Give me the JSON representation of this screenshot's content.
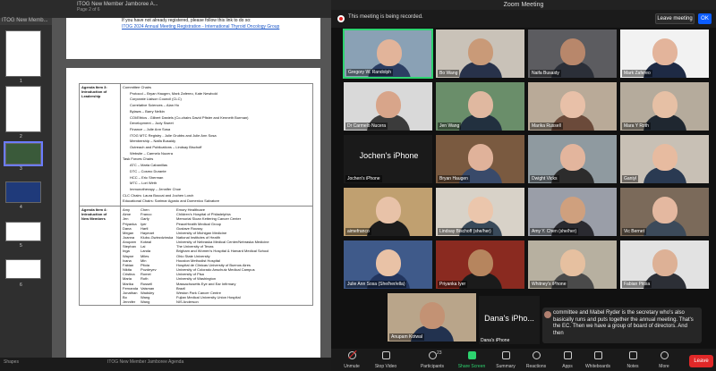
{
  "viewer": {
    "title": "ITOG New Member Jamboree A...",
    "subtitle": "Page 2 of 6",
    "window_label": "ITOG New Memb...",
    "page_numbers": [
      "1",
      "2",
      "3",
      "4",
      "5",
      "6"
    ],
    "page1_line1": "If you have not already registered, please follow this link to do so:",
    "page1_link": "ITOG 2024 Annual Meeting Registration - International Thyroid Oncology Group",
    "agenda3_head": [
      "Agenda Item 3:",
      "Introduction of",
      "Leadership"
    ],
    "leadership": [
      {
        "t": "Committee Chairs",
        "cls": ""
      },
      {
        "t": "Protocol – Bryan Haugen, Mark Zafereo, Kate Newbold",
        "cls": "bullet"
      },
      {
        "t": "Corporate Liaison Council (CLC)",
        "cls": "bullet"
      },
      {
        "t": "Correlative Sciences – Alan Ho",
        "cls": "bullet"
      },
      {
        "t": "Bylaws – Barry Nelkin",
        "cls": "bullet"
      },
      {
        "t": "COI/Ethics - Gilbert Daniels (Co-chairs David Pfister and Kenneth Burman)",
        "cls": "bullet"
      },
      {
        "t": "Development – Judy Sweet",
        "cls": "bullet"
      },
      {
        "t": "Finance – Julie Ann Sosa",
        "cls": "bullet"
      },
      {
        "t": "ITOG MTC Registry - Julie Grubbs and Julie Ann Sosa",
        "cls": "bullet"
      },
      {
        "t": "Membership – Naifa Busaidy",
        "cls": "bullet"
      },
      {
        "t": "Outreach and Publications – Lindsay Bischoff",
        "cls": "bullet"
      },
      {
        "t": "Website – Carmelo Nucera",
        "cls": "bullet"
      },
      {
        "t": "Task Forces Chairs",
        "cls": ""
      },
      {
        "t": "ATC – Maria Cabanillas",
        "cls": "bullet"
      },
      {
        "t": "DTC – Cosmo Durante",
        "cls": "bullet"
      },
      {
        "t": "HCC – Eric Sherman",
        "cls": "bullet"
      },
      {
        "t": "MTC – Lori Wirth",
        "cls": "bullet"
      },
      {
        "t": "Immunotherapy – Jennifer Choe",
        "cls": "bullet"
      },
      {
        "t": "CLC Chairs: Laura Boucai and Jochen Lorch",
        "cls": ""
      },
      {
        "t": "Educational Chairs: Sarimar Agosto and Domenico Salvatore",
        "cls": ""
      }
    ],
    "agenda4_head": [
      "Agenda Item 4:",
      "Introduction of",
      "New Members"
    ],
    "new_members": [
      [
        "Amy",
        "Chen",
        "Emory Healthcare"
      ],
      [
        "Aime",
        "Franco",
        "Children's Hospital of Philadelphia"
      ],
      [
        "Jen",
        "Garfy",
        "Memorial Sloan Kettering Cancer Center"
      ],
      [
        "Priyanka",
        "Iyer",
        "PeaceHealth Medical Group"
      ],
      [
        "Dana",
        "Hartl",
        "Gustave Roussy"
      ],
      [
        "Megan",
        "Haymart",
        "University of Michigan Medicine"
      ],
      [
        "Joanna",
        "Klubo-Gwiezdzinska",
        "National Institutes of Health"
      ],
      [
        "Anupam",
        "Kotwal",
        "University of Nebraska Medical Center/Nebraska Medicine"
      ],
      [
        "Stephan",
        "Lai",
        "The University of Texas"
      ],
      [
        "Inga",
        "Landa",
        "Brigham and Women's Hospital & Harvard Medical School"
      ],
      [
        "Wayne",
        "Miles",
        "Ohio State University"
      ],
      [
        "Ivana",
        "Min",
        "Houston Methodist Hospital"
      ],
      [
        "Fabian",
        "Pitoia",
        "Hospital de Clinicas University of Buenos Aires"
      ],
      [
        "Nikita",
        "Pozdeyev",
        "University of Colorado Anschutz Medical Campus"
      ],
      [
        "Cristina",
        "Romei",
        "University of Pisa"
      ],
      [
        "Maria",
        "Roth",
        "University of Washington"
      ],
      [
        "Marika",
        "Russell",
        "Massachusetts Eye and Ear Infirmary"
      ],
      [
        "Fernanda",
        "Vaisman",
        "Brazil"
      ],
      [
        "Jonathan",
        "Wadsley",
        "Weston Park Cancer Centre"
      ],
      [
        "Bo",
        "Wang",
        "Fujian Medical University Union Hospital"
      ],
      [
        "Jennifer",
        "Wang",
        "NIS Anderson"
      ]
    ],
    "taskbar": "ITOG New Member Jamboree Agenda",
    "taskbar_left": "Shapes"
  },
  "zoom": {
    "title": "Zoom Meeting",
    "recording_text": "This meeting is being recorded.",
    "leave_meeting": "Leave meeting",
    "ok": "OK",
    "participants": [
      {
        "name": "Gregory W. Randolph",
        "bg": "#8aa1b5",
        "skin": "#e2b49a",
        "shirt": "#2c3e63",
        "speaking": true
      },
      {
        "name": "Bo Wang",
        "bg": "#c9c2b8",
        "skin": "#c99a78",
        "shirt": "#28324a"
      },
      {
        "name": "Naifa Busaidy",
        "bg": "#5c5c60",
        "skin": "#b8876b",
        "shirt": "#2b2f38"
      },
      {
        "name": "Mark Zafereo",
        "bg": "#f2f2f2",
        "skin": "#e3b49b",
        "shirt": "#1e2a44"
      },
      {
        "name": "Dr Carmelo Nucera",
        "bg": "#d9d9d9",
        "skin": "#d8a58a",
        "shirt": "#3b3b3b"
      },
      {
        "name": "Jen Wang",
        "bg": "#6a8e6a",
        "skin": "#e0b8a0",
        "shirt": "#22303f"
      },
      {
        "name": "Marika Russell",
        "bg": "#b9aa98",
        "skin": "#e8c0a8",
        "shirt": "#6b4a3a"
      },
      {
        "name": "Mara Y Roth",
        "bg": "#b5ab9c",
        "skin": "#e6c0a5",
        "shirt": "#1f2730"
      },
      {
        "name": "Jochen's iPhone",
        "text": "Jochen's iPhone"
      },
      {
        "name": "Bryan Haugen",
        "bg": "#7a5a40",
        "skin": "#e0b29a",
        "shirt": "#394a6a"
      },
      {
        "name": "Dwight Vicks",
        "bg": "#8f9aa0",
        "skin": "#e3b59d",
        "shirt": "#2c2c2c"
      },
      {
        "name": "Ganiyl",
        "bg": "#c8c0b5",
        "skin": "#e7bba0",
        "shirt": "#2a3a52"
      },
      {
        "name": "aimefranco",
        "bg": "#c0a070",
        "skin": "#e8c2a8",
        "shirt": "#1c1c1c"
      },
      {
        "name": "Lindsay Bischoff (she/her)",
        "bg": "#d8d2c8",
        "skin": "#ebc6ac",
        "shirt": "#394a5a"
      },
      {
        "name": "Amy Y. Chen (she/her)",
        "bg": "#9a9ea8",
        "skin": "#cfa07e",
        "shirt": "#2a2a30"
      },
      {
        "name": "Vic Bernet",
        "bg": "#7b6a5a",
        "skin": "#e4b8a0",
        "shirt": "#3c4a5a"
      },
      {
        "name": "Julie Ann Sosa (She/her/ella)",
        "bg": "#3f5a8a",
        "skin": "#e9c2a6",
        "shirt": "#22355e"
      },
      {
        "name": "Priyanka Iyer",
        "bg": "#8a2a20",
        "skin": "#b6855e",
        "shirt": "#1b1b1b"
      },
      {
        "name": "Whitney's iPhone",
        "bg": "#b7b0a0",
        "skin": "#e6c0a0",
        "shirt": "#4a4a4a"
      },
      {
        "name": "Fabian Pitoia",
        "bg": "#e2e2e2",
        "skin": "#ddb196",
        "shirt": "#2c2f36"
      },
      {
        "name": "Anupam Kotwal",
        "bg": "#b9a58a",
        "skin": "#c39274",
        "shirt": "#22324f"
      }
    ],
    "dana_tile": {
      "big": "Dana's iPho...",
      "name": "Dana's iPhone"
    },
    "caption": "committee and Mabel Ryder is the secretary who's also basically runs and puts together the annual meeting. That's the EC. Then we have a group of board of directors. And then",
    "toolbar": {
      "unmute": "Unmute",
      "stop_video": "Stop Video",
      "participants": "Participants",
      "participant_count": "23",
      "share": "Share Screen",
      "summary": "Summary",
      "reactions": "Reactions",
      "apps": "Apps",
      "whiteboards": "Whiteboards",
      "notes": "Notes",
      "more": "More",
      "leave": "Leave"
    }
  }
}
